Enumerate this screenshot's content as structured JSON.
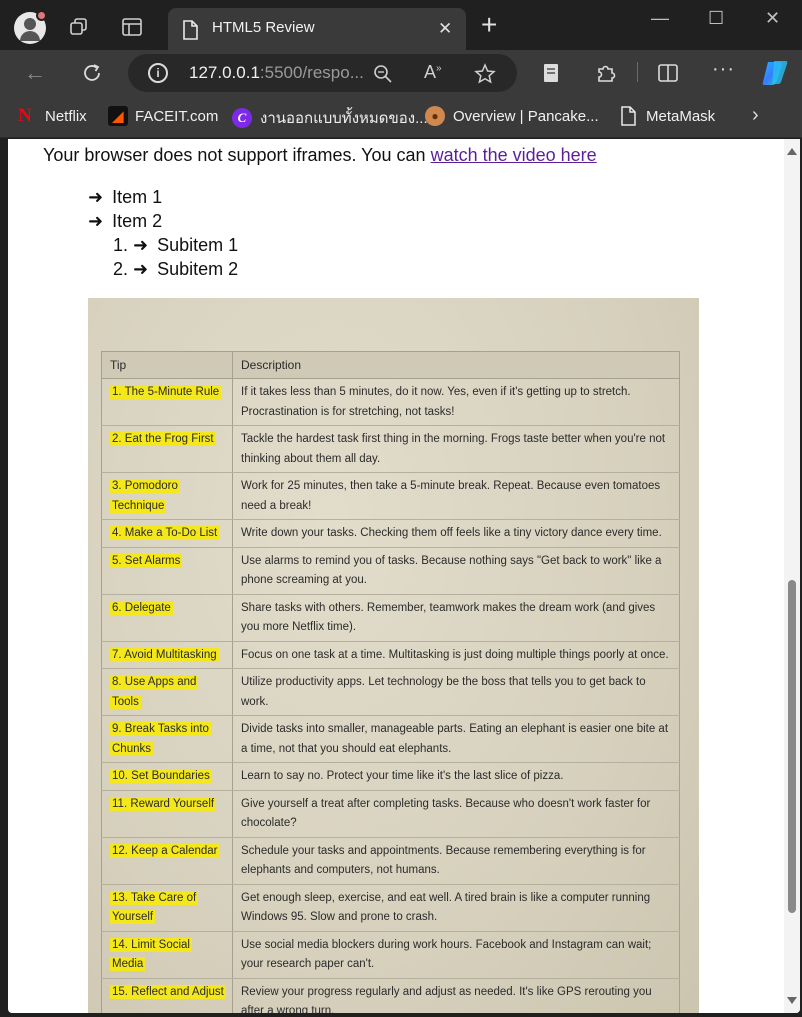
{
  "browser": {
    "tab_title": "HTML5 Review",
    "tab_close": "✕",
    "new_tab": "+",
    "window_controls": {
      "minimize": "—",
      "maximize": "☐",
      "close": "✕"
    },
    "address": {
      "host": "127.0.0.1",
      "rest": ":5500/respo..."
    },
    "bookmarks": [
      {
        "label": "Netflix",
        "icon": "netflix-icon",
        "color": "#e50914"
      },
      {
        "label": "FACEIT.com",
        "icon": "faceit-icon",
        "color": "#ff5500"
      },
      {
        "label": "งานออกแบบทั้งหมดของ...",
        "icon": "canva-icon",
        "color": "#7d2ae8"
      },
      {
        "label": "Overview | Pancake...",
        "icon": "pancakeswap-icon",
        "color": "#d1884f"
      },
      {
        "label": "MetaMask",
        "icon": "document-icon",
        "color": "#ffffff"
      }
    ]
  },
  "page": {
    "iframe_fallback_text": "Your browser does not support iframes. You can ",
    "iframe_fallback_link": "watch the video here",
    "list": [
      {
        "marker": "➜",
        "label": "Item 1"
      },
      {
        "marker": "➜",
        "label": " Item 2"
      }
    ],
    "sublist": [
      {
        "marker": "1. ➜",
        "label": "Subitem 1"
      },
      {
        "marker": "2. ➜",
        "label": "Subitem 2"
      }
    ],
    "table": {
      "headers": [
        "Tip",
        "Description"
      ],
      "rows": [
        {
          "tip": "1. The 5-Minute Rule",
          "desc": "If it takes less than 5 minutes, do it now. Yes, even if it's getting up to stretch. Procrastination is for stretching, not tasks!"
        },
        {
          "tip": "2. Eat the Frog First",
          "desc": "Tackle the hardest task first thing in the morning. Frogs taste better when you're not thinking about them all day."
        },
        {
          "tip": "3. Pomodoro Technique",
          "desc": "Work for 25 minutes, then take a 5-minute break. Repeat. Because even tomatoes need a break!"
        },
        {
          "tip": "4. Make a To-Do List",
          "desc": "Write down your tasks. Checking them off feels like a tiny victory dance every time."
        },
        {
          "tip": "5. Set Alarms",
          "desc": "Use alarms to remind you of tasks. Because nothing says \"Get back to work\" like a phone screaming at you."
        },
        {
          "tip": "6. Delegate",
          "desc": "Share tasks with others. Remember, teamwork makes the dream work (and gives you more Netflix time)."
        },
        {
          "tip": "7. Avoid Multitasking",
          "desc": "Focus on one task at a time. Multitasking is just doing multiple things poorly at once."
        },
        {
          "tip": "8. Use Apps and Tools",
          "desc": "Utilize productivity apps. Let technology be the boss that tells you to get back to work."
        },
        {
          "tip": "9. Break Tasks into Chunks",
          "desc": "Divide tasks into smaller, manageable parts. Eating an elephant is easier one bite at a time, not that you should eat elephants."
        },
        {
          "tip": "10. Set Boundaries",
          "desc": "Learn to say no. Protect your time like it's the last slice of pizza."
        },
        {
          "tip": "11. Reward Yourself",
          "desc": "Give yourself a treat after completing tasks. Because who doesn't work faster for chocolate?"
        },
        {
          "tip": "12. Keep a Calendar",
          "desc": "Schedule your tasks and appointments. Because remembering everything is for elephants and computers, not humans."
        },
        {
          "tip": "13. Take Care of Yourself",
          "desc": "Get enough sleep, exercise, and eat well. A tired brain is like a computer running Windows 95. Slow and prone to crash."
        },
        {
          "tip": "14. Limit Social Media",
          "desc": "Use social media blockers during work hours. Facebook and Instagram can wait; your research paper can't."
        },
        {
          "tip": "15. Reflect and Adjust",
          "desc": "Review your progress regularly and adjust as needed. It's like GPS rerouting you after a wrong turn."
        }
      ]
    }
  },
  "colors": {
    "highlight": "#f4e81d",
    "link": "#5b1f9a",
    "chrome_dark": "#202020",
    "chrome_mid": "#3a3a3a"
  }
}
